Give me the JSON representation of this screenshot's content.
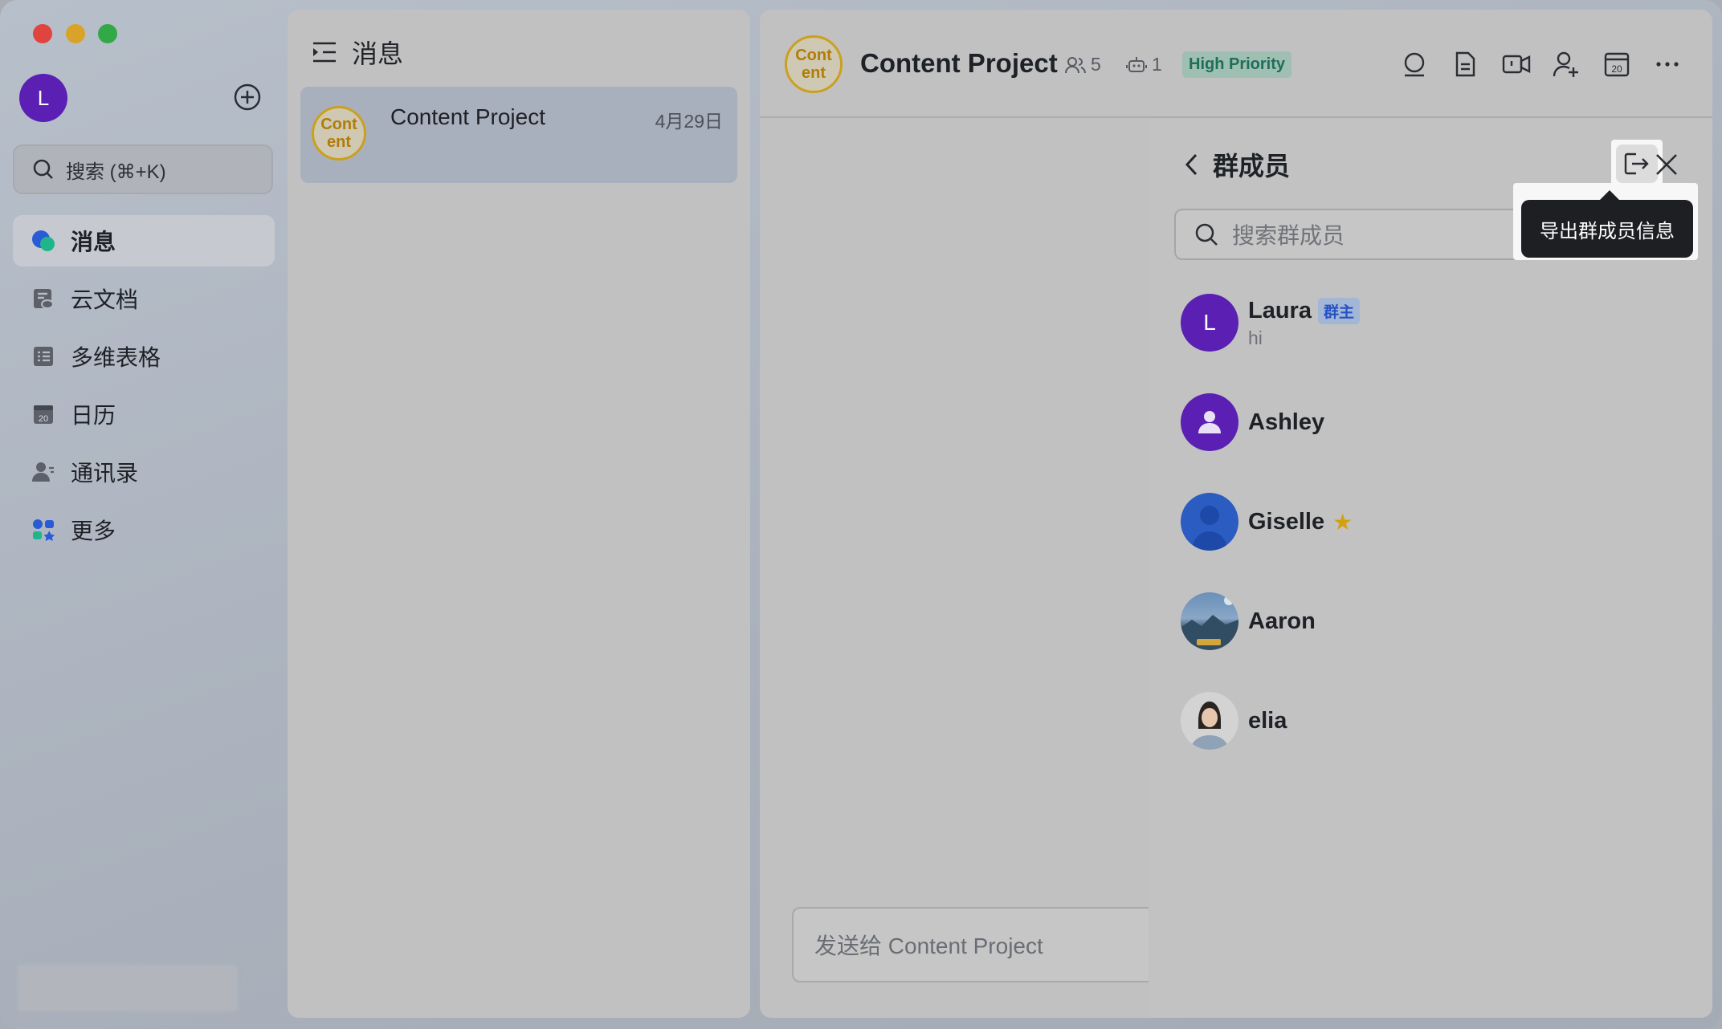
{
  "user": {
    "avatar_letter": "L"
  },
  "sidebar": {
    "search_placeholder": "搜索 (⌘+K)",
    "items": [
      {
        "label": "消息",
        "icon": "messages-icon",
        "active": true
      },
      {
        "label": "云文档",
        "icon": "cloud-docs-icon"
      },
      {
        "label": "多维表格",
        "icon": "base-table-icon"
      },
      {
        "label": "日历",
        "icon": "calendar-icon"
      },
      {
        "label": "通讯录",
        "icon": "contacts-icon"
      },
      {
        "label": "更多",
        "icon": "more-apps-icon"
      }
    ]
  },
  "list": {
    "header": "消息",
    "chats": [
      {
        "logo": "Cont ent",
        "title": "Content Project",
        "date": "4月29日"
      }
    ]
  },
  "chat": {
    "logo": "Cont ent",
    "title": "Content Project",
    "members_count": "5",
    "bots_count": "1",
    "priority": "High Priority",
    "input_placeholder": "发送给 Content Project"
  },
  "members_panel": {
    "title": "群成员",
    "search_placeholder": "搜索群成员",
    "export_tooltip": "导出群成员信息",
    "members": [
      {
        "name": "Laura",
        "badge": "群主",
        "sub": "hi",
        "avatar_letter": "L"
      },
      {
        "name": "Ashley"
      },
      {
        "name": "Giselle",
        "star": "★"
      },
      {
        "name": "Aaron"
      },
      {
        "name": "elia"
      }
    ]
  },
  "colors": {
    "accent_purple": "#5b1fb3",
    "priority_green": "#1f6e59",
    "owner_badge_blue": "#2652c2"
  }
}
